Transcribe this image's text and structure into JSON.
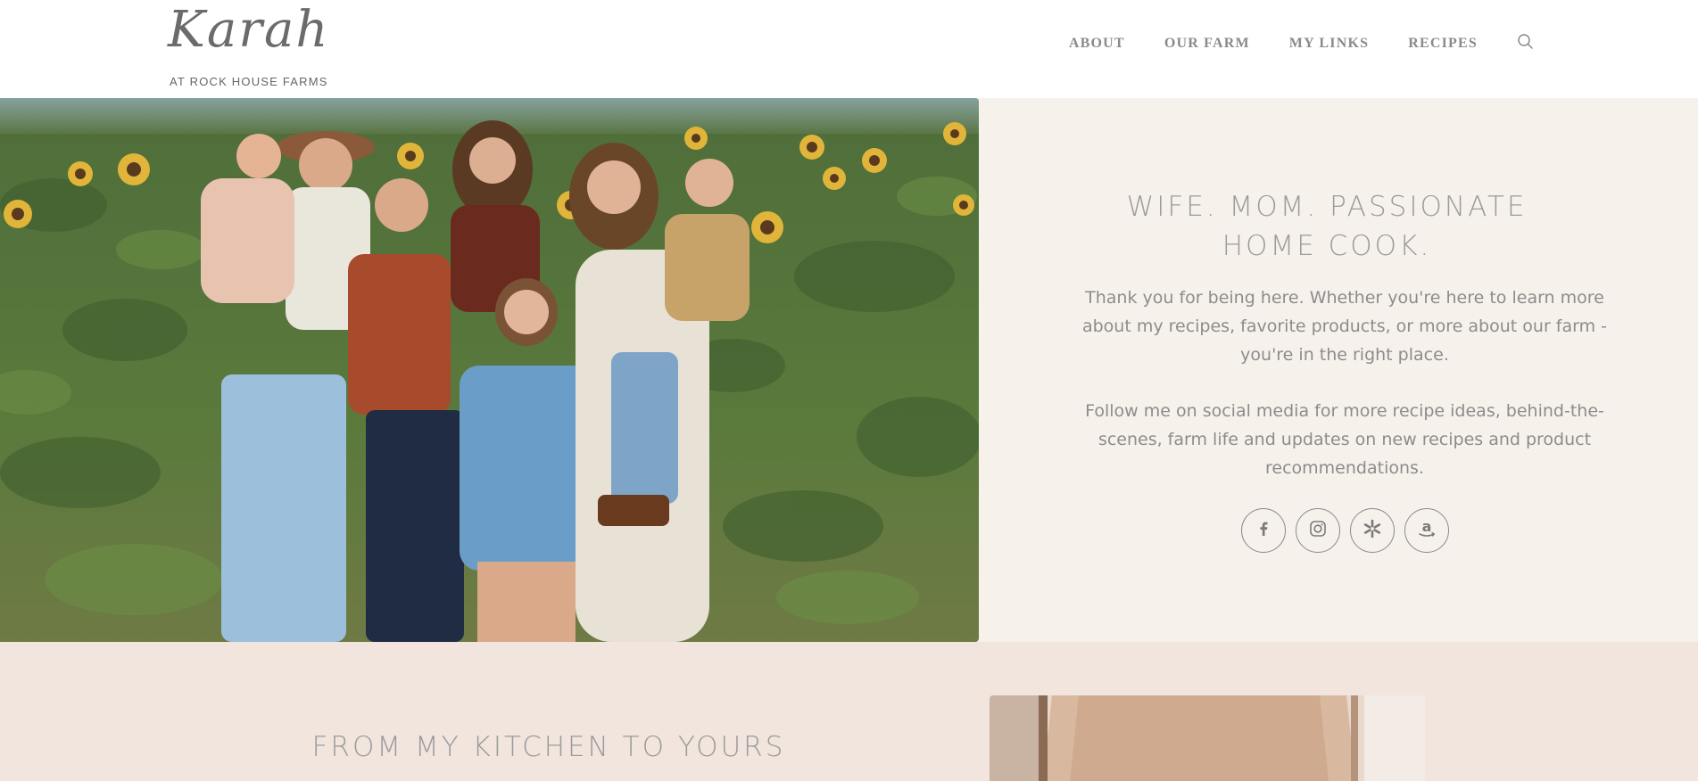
{
  "header": {
    "logo": {
      "script": "Karah",
      "tagline": "AT ROCK HOUSE FARMS"
    },
    "nav": [
      {
        "label": "ABOUT"
      },
      {
        "label": "OUR FARM"
      },
      {
        "label": "MY LINKS"
      },
      {
        "label": "RECIPES"
      }
    ],
    "search_icon": "search-icon"
  },
  "hero": {
    "photo_alt": "family-photo-sunflowers",
    "heading": "WIFE. MOM. PASSIONATE HOME COOK.",
    "paragraph_1": "Thank you for being here. Whether you're here to learn more about my recipes, favorite products, or more about our farm - you're in the right place.",
    "paragraph_2": "Follow me on social media for more recipe ideas, behind-the-scenes, farm life and updates on new recipes and product recommendations.",
    "socials": [
      {
        "icon": "facebook-icon"
      },
      {
        "icon": "instagram-icon"
      },
      {
        "icon": "walmart-icon"
      },
      {
        "icon": "amazon-icon"
      }
    ]
  },
  "kitchen": {
    "heading": "FROM MY KITCHEN TO YOURS",
    "photo_alt": "kitchen-photo"
  },
  "colors": {
    "hero_bg": "#f7f1ec",
    "lower_bg": "#f1e5de",
    "text_gray": "#8c8c8c",
    "nav_gray": "#8a8a8a"
  }
}
